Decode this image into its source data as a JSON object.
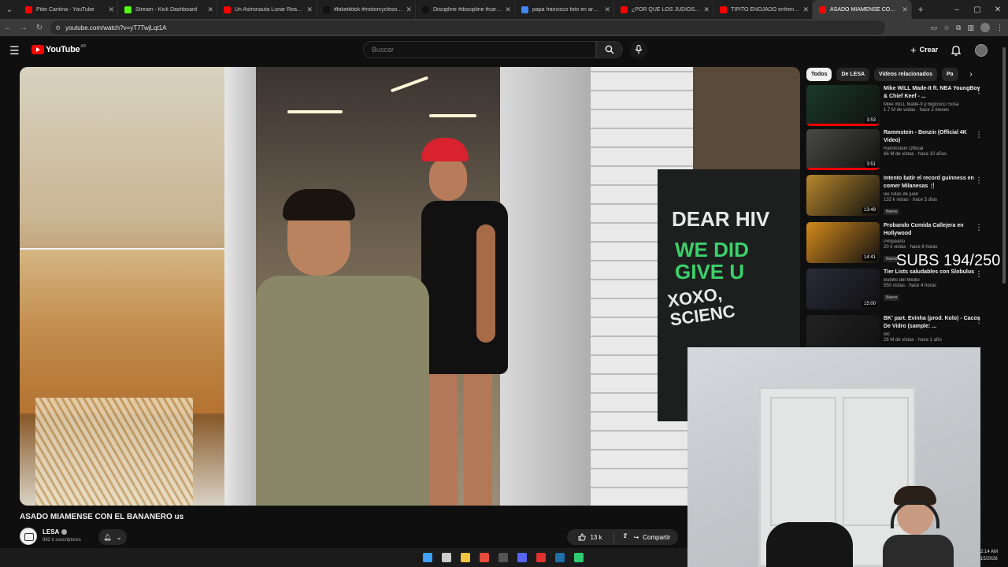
{
  "browser": {
    "tabs": [
      {
        "title": "Pibe Cantina - YouTube",
        "favicon_color": "#ff0000"
      },
      {
        "title": "Stream - Kick Dashboard",
        "favicon_color": "#53fc18"
      },
      {
        "title": "Un Astronauta Lunar Reacciona",
        "favicon_color": "#ff0000"
      },
      {
        "title": "#biketiktok #motorcyclesoftiktok",
        "favicon_color": "#111111"
      },
      {
        "title": "Discipline #discipline #carma",
        "favicon_color": "#111111"
      },
      {
        "title": "papa francisco foto en argentina",
        "favicon_color": "#4285f4"
      },
      {
        "title": "¿POR QUÉ LOS JUDÍOS TIENEN",
        "favicon_color": "#ff0000"
      },
      {
        "title": "TIPITO ENOJADO enfrenta a c",
        "favicon_color": "#ff0000"
      },
      {
        "title": "ASADO MIAMENSE CON EL B",
        "favicon_color": "#ff0000",
        "active": true
      }
    ],
    "url": "youtube.com/watch?v=yT7TwjLqt1A"
  },
  "header": {
    "logo_text": "YouTube",
    "country_code": "AR",
    "search_placeholder": "Buscar",
    "create_label": "Crear"
  },
  "video": {
    "title": "ASADO MIAMENSE CON EL BANANERO us",
    "sign_line1": "DEAR HIV",
    "sign_line2": "WE DID\nGIVE U",
    "sign_line3": "XOXO,\nSCIENC"
  },
  "channel": {
    "name": "LESA",
    "subscribers": "982 k suscriptores",
    "likes": "13 k",
    "share_label": "Compartir"
  },
  "chips": [
    "Todos",
    "De LESA",
    "Videos relacionados",
    "Pa"
  ],
  "recommendations": [
    {
      "title": "Mike WiLL Made-It ft. NBA YoungBoy & Chief Keef - ...",
      "channel": "Mike WiLL Made-It y BigGucci Sosa",
      "meta": "1.7 M de vistas · hace 2 meses",
      "duration": "3:53",
      "thumb": "#1a3a2a",
      "badge": "",
      "progress": 1
    },
    {
      "title": "Rammstein - Benzin (Official 4K Video)",
      "channel": "Rammstein Official",
      "meta": "66 M de vistas · hace 10 años",
      "duration": "3:51",
      "thumb": "#4a4a44",
      "badge": "",
      "progress": 1
    },
    {
      "title": "Intento batir el record guinness en comer Milanesas 🍴",
      "channel": "las rutas de juan",
      "meta": "133 k vistas · hace 5 días",
      "duration": "13:49",
      "thumb": "#b8872c",
      "badge": "Nuevo",
      "progress": 0
    },
    {
      "title": "Probando Comida Callejera en Hollywood",
      "channel": "Pimpeano",
      "meta": "20 k vistas · hace 6 horas",
      "duration": "14:41",
      "thumb": "#d48a1c",
      "badge": "Nuevo",
      "progress": 0
    },
    {
      "title": "Tier Lists saludables con Slobulus",
      "channel": "Bubillo del Medio",
      "meta": "550 vistas · hace 4 horas",
      "duration": "15:00",
      "thumb": "#2a2a3a",
      "badge": "Nuevo",
      "progress": 0
    },
    {
      "title": "BK' part. Evinha (prod. Kolo) - Cacos De Vidro (sample: ...",
      "channel": "BK'",
      "meta": "26 M de vistas · hace 1 año",
      "duration": "",
      "thumb": "#222222",
      "badge": "",
      "progress": 0
    }
  ],
  "overlay": {
    "subs_text": "SUBS 194/250"
  },
  "taskbar": {
    "clock_time": "2:14 AM",
    "clock_date": "15/2026",
    "icons": [
      {
        "name": "windows-start-icon",
        "color": "#3fa0ff"
      },
      {
        "name": "search-icon",
        "color": "#cccccc"
      },
      {
        "name": "file-explorer-icon",
        "color": "#f5c542"
      },
      {
        "name": "chrome-icon",
        "color": "#e84c3d"
      },
      {
        "name": "obs-icon",
        "color": "#555555"
      },
      {
        "name": "discord-icon",
        "color": "#5865f2"
      },
      {
        "name": "app-icon",
        "color": "#e03030"
      },
      {
        "name": "steam-icon",
        "color": "#1e6ea8"
      },
      {
        "name": "app-icon-2",
        "color": "#2ecc71"
      }
    ]
  }
}
